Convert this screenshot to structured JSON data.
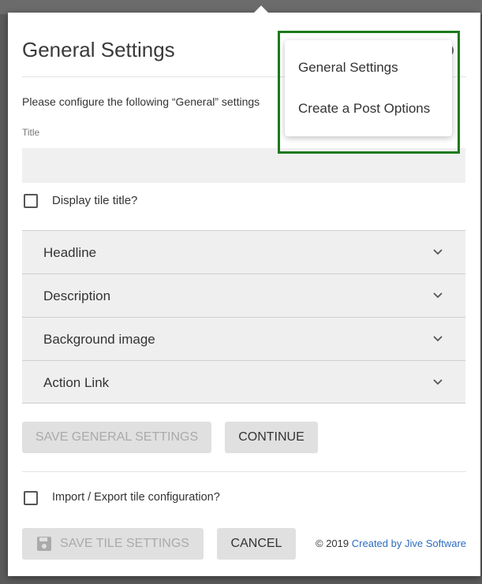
{
  "dialog": {
    "title": "General Settings",
    "instructions": "Please configure the following “General” settings",
    "title_field": {
      "label": "Title",
      "value": "",
      "placeholder": ""
    },
    "display_title_checkbox": {
      "label": "Display tile title?",
      "checked": false
    },
    "sections": [
      {
        "label": "Headline",
        "icon": "chevron-down-icon"
      },
      {
        "label": "Description",
        "icon": "chevron-down-icon"
      },
      {
        "label": "Background image",
        "icon": "chevron-down-icon"
      },
      {
        "label": "Action Link",
        "icon": "chevron-down-icon"
      }
    ],
    "save_general_label": "SAVE GENERAL SETTINGS",
    "continue_label": "CONTINUE",
    "import_export_checkbox": {
      "label": "Import / Export tile configuration?",
      "checked": false
    },
    "save_tile_label": "SAVE TILE SETTINGS",
    "cancel_label": "CANCEL",
    "copyright": "© 2019",
    "footer_link": "Created by Jive Software"
  },
  "dropdown_menu": {
    "items": [
      {
        "label": "General Settings"
      },
      {
        "label": "Create a Post Options"
      }
    ],
    "highlight_color": "#1c7a1c"
  },
  "colors": {
    "link": "#2d6cc0",
    "button_bg": "#e0e0e0",
    "accordion_bg": "#efefef"
  }
}
